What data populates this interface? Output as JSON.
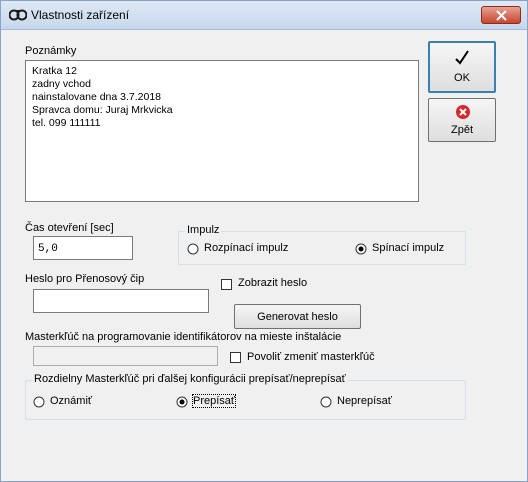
{
  "window": {
    "title": "Vlastnosti zařízení"
  },
  "notes": {
    "label": "Poznámky",
    "lines": [
      "Kratka 12",
      "zadny vchod",
      "nainstalovane dna 3.7.2018",
      "Spravca domu: Juraj Mrkvicka",
      "tel. 099 111111"
    ]
  },
  "buttons": {
    "ok": "OK",
    "back": "Zpět",
    "generate": "Generovat heslo"
  },
  "open_time": {
    "label": "Čas otevření [sec]",
    "value": "5,0"
  },
  "impulse": {
    "title": "Impulz",
    "options": [
      {
        "label": "Rozpínací impulz",
        "selected": false
      },
      {
        "label": "Spínací impulz",
        "selected": true
      }
    ]
  },
  "password": {
    "label": "Heslo pro Přenosový čip",
    "value": "",
    "show_label": "Zobrazit heslo",
    "show_checked": false
  },
  "masterkey": {
    "label": "Masterkľúč na programovanie identifikátorov na mieste inštalácie",
    "value": "",
    "allow_label": "Povoliť zmeniť masterkľúč",
    "allow_checked": false
  },
  "diff_masterkey": {
    "title": "Rozdielny Masterkľúč pri ďalšej konfigurácii prepísať/neprepísať",
    "options": [
      {
        "label": "Oznámiť",
        "selected": false
      },
      {
        "label": "Prepísať",
        "selected": true
      },
      {
        "label": "Neprepísať",
        "selected": false
      }
    ]
  }
}
